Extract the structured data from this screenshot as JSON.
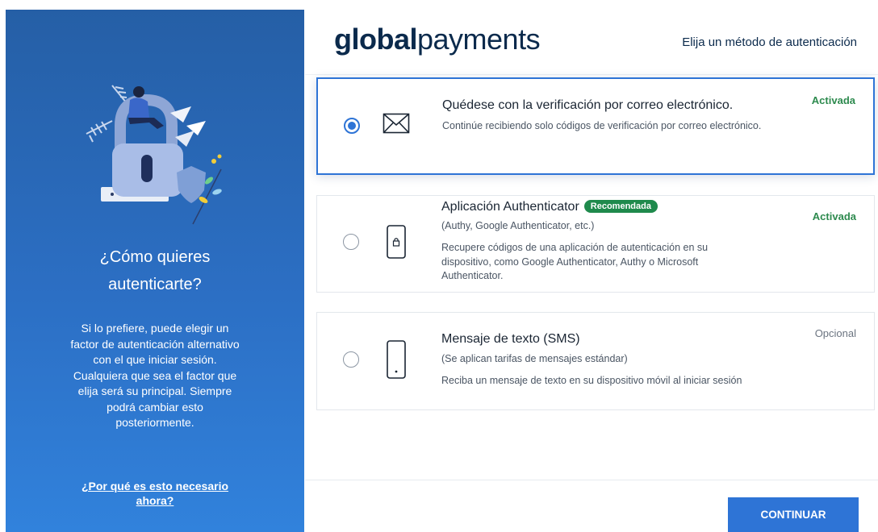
{
  "brand": {
    "bold": "global",
    "rest": "payments"
  },
  "header": {
    "title": "Elija un método de autenticación"
  },
  "left_panel": {
    "title": "¿Cómo quieres autenticarte?",
    "description": "Si lo prefiere, puede elegir un factor de autenticación alternativo con el que iniciar sesión. Cualquiera que sea el factor que elija será su principal. Siempre podrá cambiar esto posteriormente.",
    "link": "¿Por qué es esto necesario ahora?",
    "illustration_icon": "security-lock-illustration"
  },
  "options": [
    {
      "icon": "envelope-icon",
      "title": "Quédese con la verificación por correo electrónico.",
      "description": "Continúe recibiendo solo códigos de verificación por correo electrónico.",
      "status": "Activada",
      "selected": true
    },
    {
      "icon": "phone-lock-icon",
      "title": "Aplicación Authenticator",
      "badge": "Recomendada",
      "subtitle": "(Authy, Google Authenticator, etc.)",
      "description": "Recupere códigos de una aplicación de autenticación en su dispositivo, como Google Authenticator, Authy o Microsoft Authenticator.",
      "status": "Activada",
      "selected": false
    },
    {
      "icon": "mobile-phone-icon",
      "title": "Mensaje de texto (SMS)",
      "subtitle": "(Se aplican tarifas de mensajes estándar)",
      "description": "Reciba un mensaje de texto en su dispositivo móvil al iniciar sesión",
      "status": "Opcional",
      "selected": false
    }
  ],
  "footer": {
    "continue_label": "CONTINUAR"
  },
  "colors": {
    "accent": "#2e74d6",
    "panel": "#2c6fc4",
    "active": "#2d8a4e",
    "badge": "#1f8a4c"
  }
}
